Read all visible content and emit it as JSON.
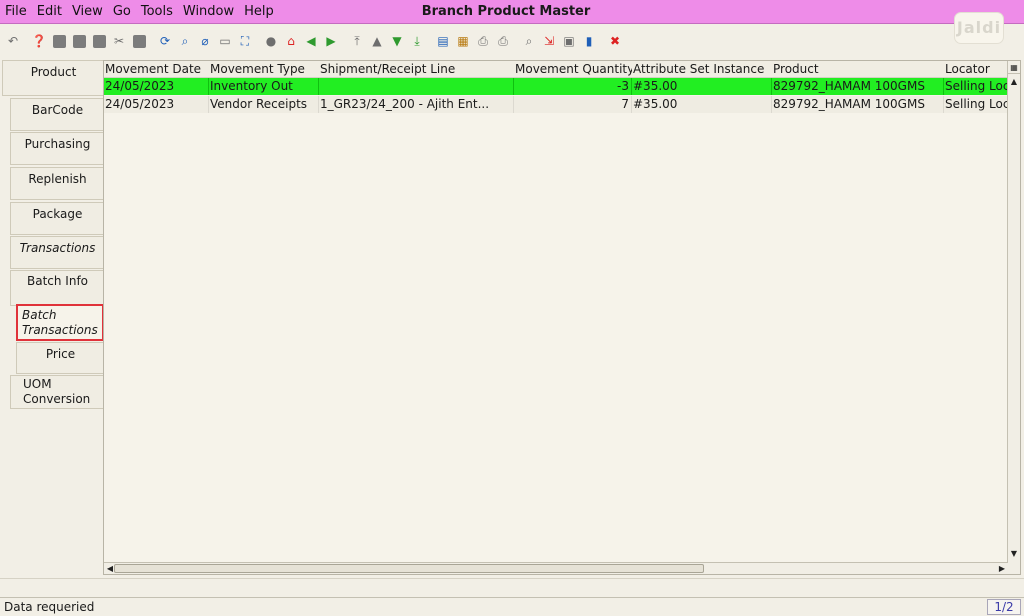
{
  "window": {
    "title": "Branch Product Master",
    "badge": "Jaldi"
  },
  "menu": [
    {
      "label": "File"
    },
    {
      "label": "Edit"
    },
    {
      "label": "View"
    },
    {
      "label": "Go"
    },
    {
      "label": "Tools"
    },
    {
      "label": "Window"
    },
    {
      "label": "Help"
    }
  ],
  "toolbar": {
    "icons": [
      "undo-icon",
      "help-icon",
      "new-record-icon",
      "copy-record-icon",
      "delete-icon",
      "delete-selection-icon",
      "save-icon",
      "refresh-icon",
      "find-icon",
      "attachment-icon",
      "chat-icon",
      "zoom-icon",
      "history-icon",
      "home-icon",
      "parent-icon",
      "detail-icon",
      "first-record-icon",
      "previous-record-icon",
      "next-record-icon",
      "last-record-icon",
      "report-icon",
      "archive-icon",
      "print-icon",
      "print-preview-icon",
      "zoom-across-icon",
      "workflow-icon",
      "request-icon",
      "product-info-icon",
      "end-icon"
    ]
  },
  "tabs": [
    {
      "label": "Product"
    },
    {
      "label": "BarCode"
    },
    {
      "label": "Purchasing"
    },
    {
      "label": "Replenish"
    },
    {
      "label": "Package"
    },
    {
      "label": "Transactions"
    },
    {
      "label": "Batch Info"
    },
    {
      "label": "Batch Transactions",
      "selected": true
    },
    {
      "label": "Price"
    },
    {
      "label": "UOM Conversion"
    }
  ],
  "grid": {
    "columns": [
      "Movement Date",
      "Movement Type",
      "Shipment/Receipt Line",
      "Movement Quantity",
      "Attribute Set Instance",
      "Product",
      "Locator"
    ],
    "rows": [
      [
        "24/05/2023",
        "Inventory Out",
        "",
        "-3",
        "#35.00",
        "829792_HAMAM 100GMS",
        "Selling Loc"
      ],
      [
        "24/05/2023",
        "Vendor Receipts",
        "1_GR23/24_200 - Ajith Ent...",
        "7",
        "#35.00",
        "829792_HAMAM 100GMS",
        "Selling Loc"
      ]
    ]
  },
  "status": {
    "message": "Data requeried",
    "page": "1/2"
  },
  "colors": {
    "menubar": "#ee8ce8",
    "highlight_row": "#22ee22",
    "selected_tab_border": "#e0323a"
  }
}
